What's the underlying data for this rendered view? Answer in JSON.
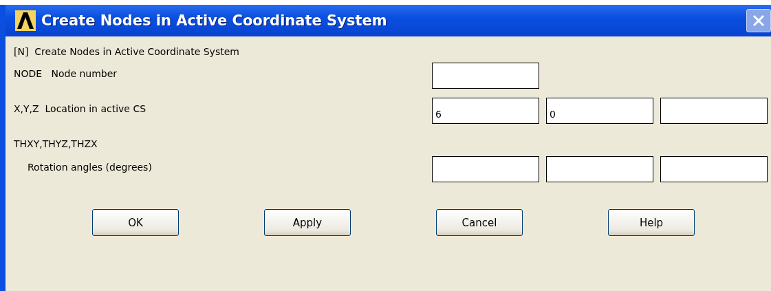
{
  "window": {
    "title": "Create Nodes in Active Coordinate System"
  },
  "heading": "[N]  Create Nodes in Active Coordinate System",
  "rows": [
    {
      "kind": "field",
      "label": "NODE   Node number",
      "inputs": [
        {
          "kind": "text"
        }
      ]
    },
    {
      "kind": "field",
      "label": "X,Y,Z  Location in active CS",
      "inputs": [
        {
          "kind": "text",
          "value": "6"
        },
        {
          "kind": "text",
          "value": "0"
        },
        {
          "kind": "text"
        }
      ]
    },
    {
      "kind": "caption",
      "label": "THXY,THYZ,THZX"
    },
    {
      "kind": "indented",
      "label": "Rotation angles (degrees)",
      "inputs": [
        {
          "kind": "text"
        },
        {
          "kind": "text"
        },
        {
          "kind": "text"
        }
      ]
    }
  ],
  "buttons": [
    "OK",
    "Apply",
    "Cancel",
    "Help"
  ]
}
